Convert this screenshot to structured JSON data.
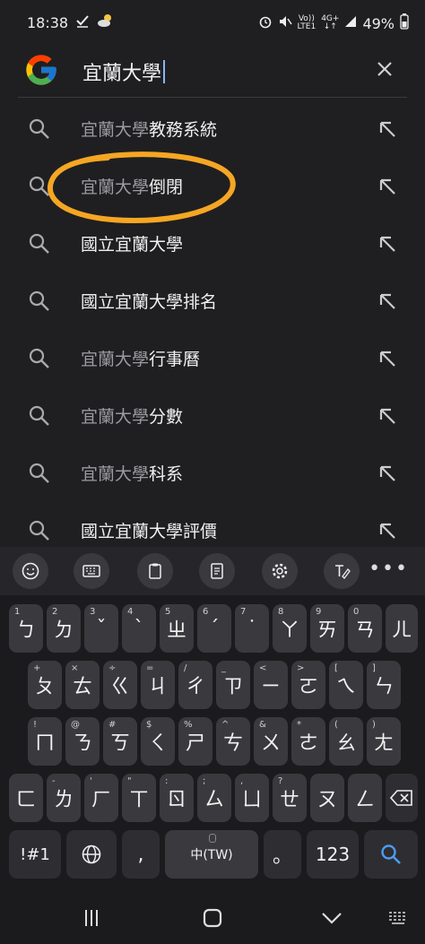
{
  "status_bar": {
    "time": "18:38",
    "network_top": "Vo))",
    "network_bottom": "LTE1",
    "data_top": "4G+",
    "data_bottom": "↓↑",
    "battery": "49%"
  },
  "search": {
    "query": "宜蘭大學"
  },
  "suggestions": [
    {
      "prefix": "宜蘭大學",
      "rest": "教務系統",
      "full": ""
    },
    {
      "prefix": "宜蘭大學",
      "rest": "倒閉",
      "full": ""
    },
    {
      "prefix": "",
      "rest": "",
      "full": "國立宜蘭大學"
    },
    {
      "prefix": "",
      "rest": "",
      "full": "國立宜蘭大學排名"
    },
    {
      "prefix": "宜蘭大學",
      "rest": "行事曆",
      "full": ""
    },
    {
      "prefix": "宜蘭大學",
      "rest": "分數",
      "full": ""
    },
    {
      "prefix": "宜蘭大學",
      "rest": "科系",
      "full": ""
    },
    {
      "prefix": "",
      "rest": "",
      "full": "國立宜蘭大學評價"
    }
  ],
  "annotation": {
    "color": "#f5a623"
  },
  "keyboard": {
    "row1": [
      {
        "label": "ㄅ",
        "hint": "1"
      },
      {
        "label": "ㄉ",
        "hint": "2"
      },
      {
        "label": "ˇ",
        "hint": "3"
      },
      {
        "label": "ˋ",
        "hint": "4"
      },
      {
        "label": "ㄓ",
        "hint": "5"
      },
      {
        "label": "ˊ",
        "hint": "6"
      },
      {
        "label": "˙",
        "hint": "7"
      },
      {
        "label": "ㄚ",
        "hint": "8"
      },
      {
        "label": "ㄞ",
        "hint": "9"
      },
      {
        "label": "ㄢ",
        "hint": "0"
      },
      {
        "label": "ㄦ",
        "hint": ""
      }
    ],
    "row2": [
      {
        "label": "ㄆ",
        "hint": "+"
      },
      {
        "label": "ㄊ",
        "hint": "×"
      },
      {
        "label": "ㄍ",
        "hint": "÷"
      },
      {
        "label": "ㄐ",
        "hint": "="
      },
      {
        "label": "ㄔ",
        "hint": "/"
      },
      {
        "label": "ㄗ",
        "hint": "_"
      },
      {
        "label": "ㄧ",
        "hint": "<"
      },
      {
        "label": "ㄛ",
        "hint": ">"
      },
      {
        "label": "ㄟ",
        "hint": "["
      },
      {
        "label": "ㄣ",
        "hint": "]"
      }
    ],
    "row3": [
      {
        "label": "ㄇ",
        "hint": "!"
      },
      {
        "label": "ㄋ",
        "hint": "@"
      },
      {
        "label": "ㄎ",
        "hint": "#"
      },
      {
        "label": "ㄑ",
        "hint": "$"
      },
      {
        "label": "ㄕ",
        "hint": "%"
      },
      {
        "label": "ㄘ",
        "hint": "^"
      },
      {
        "label": "ㄨ",
        "hint": "&"
      },
      {
        "label": "ㄜ",
        "hint": "*"
      },
      {
        "label": "ㄠ",
        "hint": "("
      },
      {
        "label": "ㄤ",
        "hint": ")"
      }
    ],
    "row4": [
      {
        "label": "ㄈ",
        "hint": ""
      },
      {
        "label": "ㄌ",
        "hint": "-"
      },
      {
        "label": "ㄏ",
        "hint": "'"
      },
      {
        "label": "ㄒ",
        "hint": "\""
      },
      {
        "label": "ㄖ",
        "hint": ":"
      },
      {
        "label": "ㄙ",
        "hint": ";"
      },
      {
        "label": "ㄩ",
        "hint": ","
      },
      {
        "label": "ㄝ",
        "hint": "?"
      },
      {
        "label": "ㄡ",
        "hint": ""
      },
      {
        "label": "ㄥ",
        "hint": ""
      }
    ],
    "symbols_label": "!#1",
    "comma_label": ",",
    "space_label": "中(TW)",
    "period_label": "。",
    "numbers_label": "123"
  },
  "icons": {
    "toolbar": [
      "emoji-icon",
      "keyboard-icon",
      "clipboard-icon",
      "notes-icon",
      "settings-icon",
      "handwriting-icon"
    ]
  }
}
